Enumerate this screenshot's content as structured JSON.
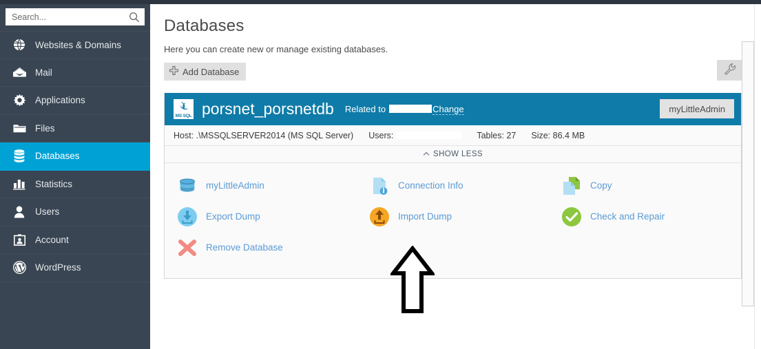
{
  "search": {
    "placeholder": "Search...",
    "value": "",
    "icon": "search-icon"
  },
  "sidebar": {
    "items": [
      {
        "label": "Websites & Domains",
        "icon": "globe-icon",
        "active": false
      },
      {
        "label": "Mail",
        "icon": "envelope-icon",
        "active": false
      },
      {
        "label": "Applications",
        "icon": "gear-icon",
        "active": false
      },
      {
        "label": "Files",
        "icon": "folder-icon",
        "active": false
      },
      {
        "label": "Databases",
        "icon": "database-icon",
        "active": true
      },
      {
        "label": "Statistics",
        "icon": "bar-chart-icon",
        "active": false
      },
      {
        "label": "Users",
        "icon": "user-icon",
        "active": false
      },
      {
        "label": "Account",
        "icon": "id-card-icon",
        "active": false
      },
      {
        "label": "WordPress",
        "icon": "wordpress-icon",
        "active": false
      }
    ],
    "active_color": "#00a2d6",
    "background_color": "#394552"
  },
  "main": {
    "title": "Databases",
    "subtitle": "Here you can create new or manage existing databases.",
    "toolbar": {
      "add_database_label": "Add Database",
      "add_icon": "plus-icon",
      "settings_icon": "wrench-icon"
    }
  },
  "database": {
    "logo_text": "MS SQL",
    "logo_icon": "mssql-logo-icon",
    "name": "porsnet_porsnetdb",
    "related_label": "Related to",
    "related_value": "",
    "change_link": "Change",
    "admin_button": "myLittleAdmin",
    "header_color": "#0f7ba8",
    "info": {
      "host_label": "Host:",
      "host_value": ".\\MSSQLSERVER2014 (MS SQL Server)",
      "users_label": "Users:",
      "users_value": "",
      "tables_label": "Tables:",
      "tables_value": "27",
      "size_label": "Size:",
      "size_value": "86.4 MB"
    },
    "show_less_label": "SHOW LESS",
    "show_less_icon": "chevron-up-icon",
    "actions": [
      [
        {
          "label": "myLittleAdmin",
          "icon": "database-cylinder-icon",
          "color": "#57b0dd"
        },
        {
          "label": "Connection Info",
          "icon": "document-info-icon",
          "color": "#b3dff5"
        },
        {
          "label": "Copy",
          "icon": "copy-pages-icon",
          "color": "#8dc63f"
        }
      ],
      [
        {
          "label": "Export Dump",
          "icon": "download-circle-icon",
          "color": "#7ecdf0"
        },
        {
          "label": "Import Dump",
          "icon": "upload-circle-icon",
          "color": "#f5a623"
        },
        {
          "label": "Check and Repair",
          "icon": "check-circle-icon",
          "color": "#8dc63f"
        }
      ],
      [
        {
          "label": "Remove Database",
          "icon": "red-x-icon",
          "color": "#f28b82"
        }
      ]
    ],
    "annotation": {
      "icon": "up-arrow-annotation",
      "color": "#000000"
    }
  }
}
